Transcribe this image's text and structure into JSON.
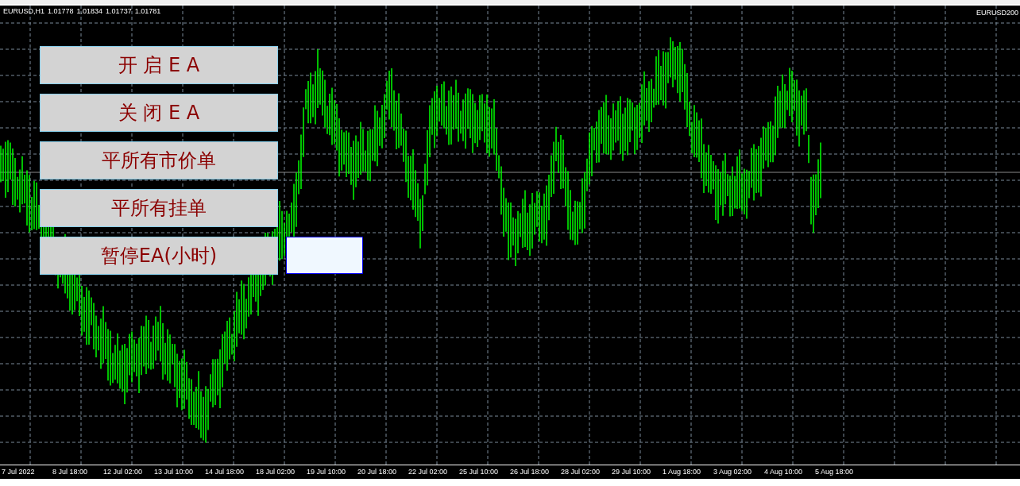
{
  "chart_header": {
    "symbol": "EURUSD,H1",
    "prices": [
      "1.01778",
      "1.01834",
      "1.01737",
      "1.01781"
    ],
    "indicator": "EURUSD200"
  },
  "buttons": [
    {
      "label": "开 启 E A"
    },
    {
      "label": "关 闭 E A"
    },
    {
      "label": "平所有市价单"
    },
    {
      "label": "平所有挂单"
    },
    {
      "label": "暂停EA(小时)"
    }
  ],
  "time_axis": [
    "7 Jul 2022",
    "8 Jul 18:00",
    "12 Jul 02:00",
    "13 Jul 10:00",
    "14 Jul 18:00",
    "18 Jul 02:00",
    "19 Jul 10:00",
    "20 Jul 18:00",
    "22 Jul 02:00",
    "25 Jul 10:00",
    "26 Jul 18:00",
    "28 Jul 02:00",
    "29 Jul 10:00",
    "1 Aug 18:00",
    "3 Aug 02:00",
    "4 Aug 10:00",
    "5 Aug 18:00"
  ]
}
